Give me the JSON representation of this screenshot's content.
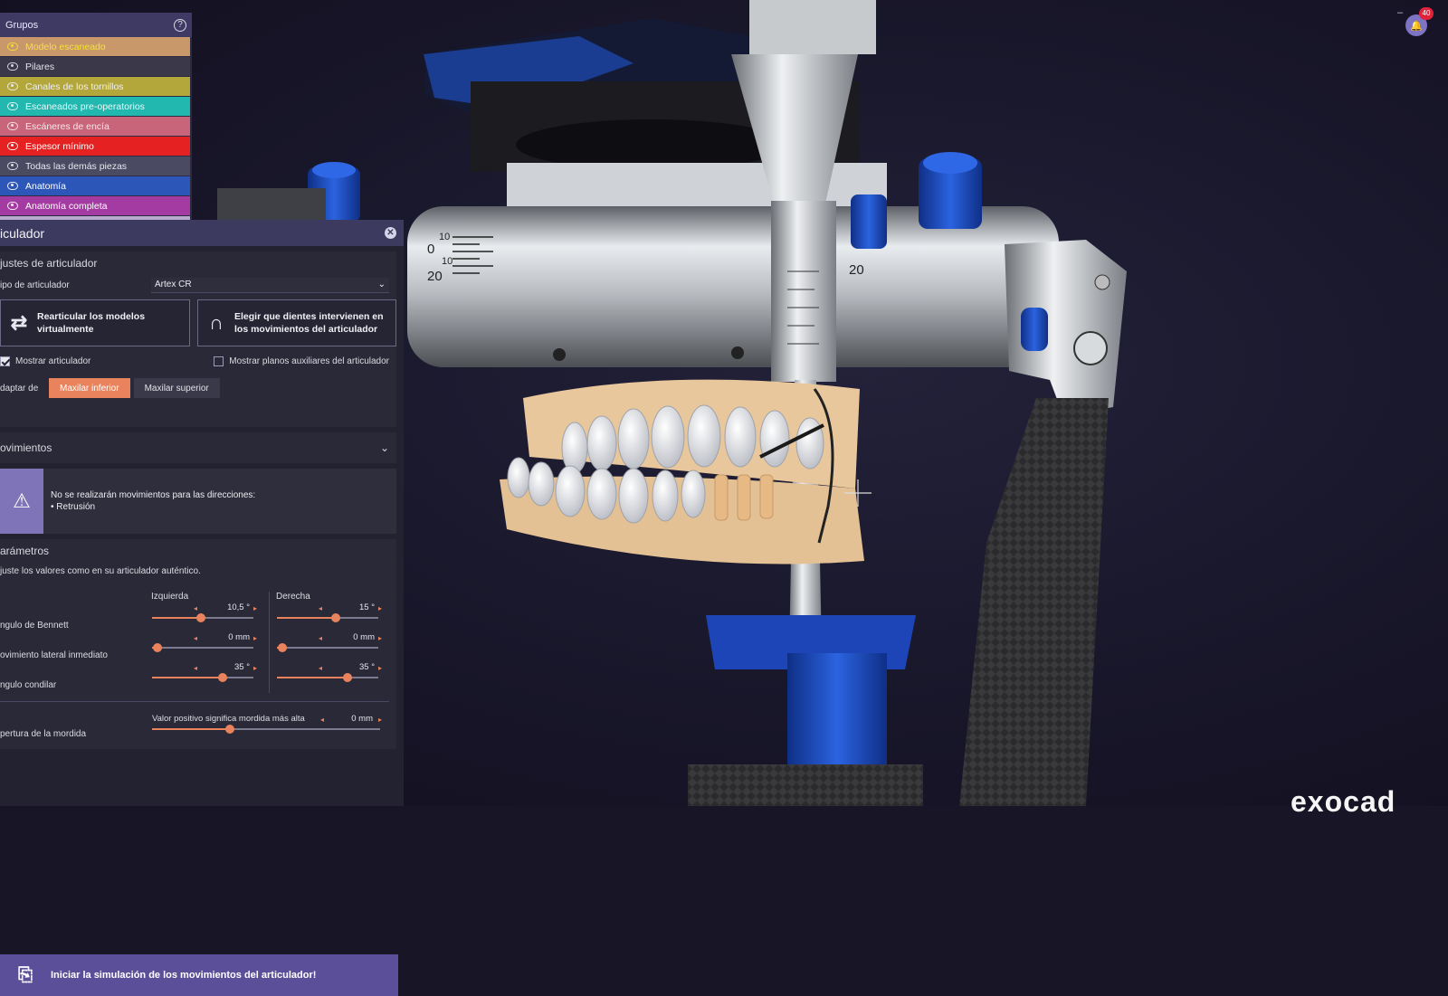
{
  "groups": {
    "title": "Grupos",
    "items": [
      {
        "label": "Modelo escaneado",
        "bg": "#c8976a",
        "fg": "#f3e23a"
      },
      {
        "label": "Pilares",
        "bg": "#3a3849",
        "fg": "#e4e4ec"
      },
      {
        "label": "Canales de los tornillos",
        "bg": "#b3a63a",
        "fg": "#f0f0f0"
      },
      {
        "label": "Escaneados pre-operatorios",
        "bg": "#22b8b0",
        "fg": "#eaf9f8"
      },
      {
        "label": "Escáneres de encía",
        "bg": "#c9657a",
        "fg": "#f5e7ea"
      },
      {
        "label": "Espesor mínimo",
        "bg": "#e52121",
        "fg": "#ffffff"
      },
      {
        "label": "Todas las demás piezas",
        "bg": "#4a4a62",
        "fg": "#e8e8f0"
      },
      {
        "label": "Anatomía",
        "bg": "#2c56b8",
        "fg": "#ffffff"
      },
      {
        "label": "Anatomía completa",
        "bg": "#a43ba2",
        "fg": "#ffffff"
      }
    ]
  },
  "panel": {
    "title": "iculador",
    "ajustes": {
      "header": "justes de articulador",
      "tipo_label": "ipo de articulador",
      "tipo_value": "Artex CR",
      "btn_rearticular": "Rearticular los modelos virtualmente",
      "btn_elegir": "Elegir que dientes intervienen en los movimientos del articulador",
      "cb_mostrar": "Mostrar articulador",
      "cb_mostrar_checked": true,
      "cb_planos": "Mostrar planos auxiliares del articulador",
      "cb_planos_checked": false,
      "adaptar_label": "daptar de",
      "tab_inferior": "Maxilar inferior",
      "tab_superior": "Maxilar superior",
      "active_tab": "inferior"
    },
    "movimientos": {
      "header": "ovimientos",
      "warning_line1": "No se realizarán movimientos para las direcciones:",
      "warning_line2": "• Retrusión"
    },
    "parametros": {
      "header": "arámetros",
      "hint": "juste los valores como en su articulador auténtico.",
      "col_left": "Izquierda",
      "col_right": "Derecha",
      "rows": [
        {
          "label": "ngulo de Bennett",
          "left": "10,5 °",
          "right": "15 °",
          "left_level": 0.48,
          "right_level": 0.58
        },
        {
          "label": "ovimiento lateral inmediato",
          "left": "0 mm",
          "right": "0 mm",
          "left_level": 0.05,
          "right_level": 0.05
        },
        {
          "label": "ngulo condilar",
          "left": "35 °",
          "right": "35 °",
          "left_level": 0.7,
          "right_level": 0.7
        }
      ],
      "apertura_label": "pertura de la mordida",
      "apertura_hint": "Valor positivo significa mordida más alta",
      "apertura_value": "0 mm",
      "apertura_level": 0.34
    },
    "start_button": "Iniciar la simulación de los movimientos del articulador!"
  },
  "window": {
    "minimize": "–",
    "notification_count": "40",
    "brand": "exocad"
  },
  "viewport": {
    "scale_marks": [
      "0",
      "10",
      "10",
      "20",
      "20"
    ]
  },
  "colors": {
    "accent": "#e8835e",
    "panel_header": "#3d3a60",
    "start_button": "#5c4f9a",
    "warning": "#7f74b8"
  }
}
